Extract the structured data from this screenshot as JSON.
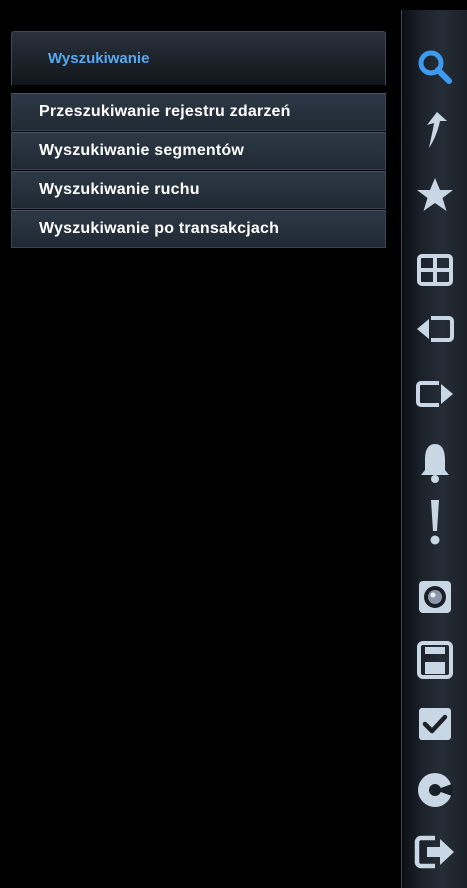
{
  "search_menu": {
    "title": "Wyszukiwanie",
    "items": [
      {
        "label": "Przeszukiwanie rejestru zdarzeń"
      },
      {
        "label": "Wyszukiwanie segmentów"
      },
      {
        "label": "Wyszukiwanie ruchu"
      },
      {
        "label": "Wyszukiwanie po transakcjach"
      }
    ]
  },
  "toolbar": {
    "icons": [
      "search-icon",
      "playback-arrow-icon",
      "star-icon",
      "grid-layout-icon",
      "previous-page-icon",
      "next-page-icon",
      "bell-icon",
      "alert-exclamation-icon",
      "camera-snapshot-icon",
      "save-disk-icon",
      "checkbox-icon",
      "disc-backup-icon",
      "logout-icon"
    ]
  },
  "colors": {
    "background": "#000000",
    "menu_title": "#57a8f0",
    "menu_item_bg": "#26313d",
    "search_icon": "#3d9bf0",
    "toolbar_icons": "#c9d6e4"
  }
}
